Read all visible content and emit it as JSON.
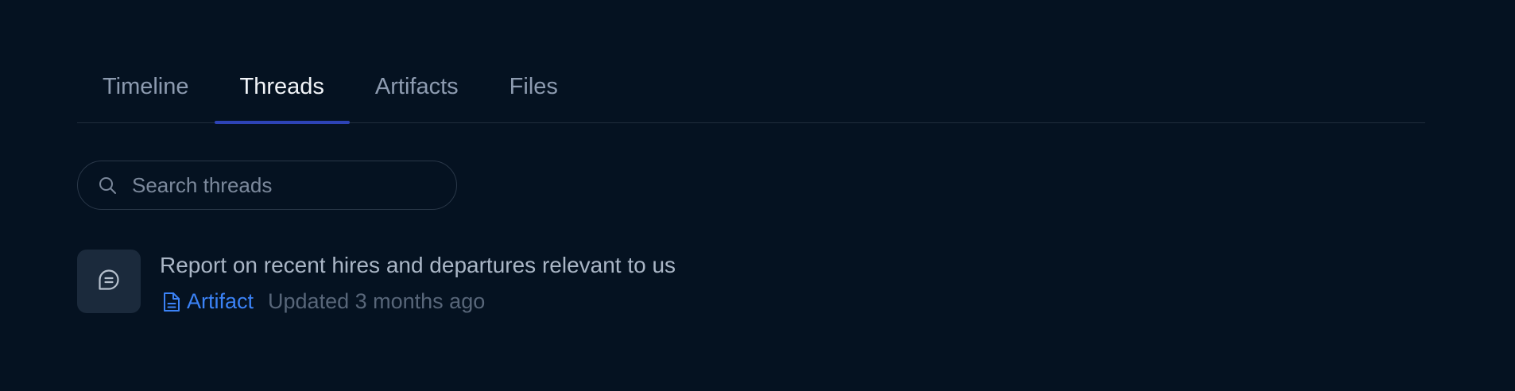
{
  "tabs": [
    {
      "label": "Timeline",
      "active": false
    },
    {
      "label": "Threads",
      "active": true
    },
    {
      "label": "Artifacts",
      "active": false
    },
    {
      "label": "Files",
      "active": false
    }
  ],
  "search": {
    "placeholder": "Search threads",
    "value": ""
  },
  "threads": [
    {
      "title": "Report on recent hires and departures relevant to us",
      "icon": "chat-bubble-icon",
      "badge": {
        "label": "Artifact",
        "icon": "document-icon"
      },
      "updated": "Updated 3 months ago"
    }
  ],
  "colors": {
    "background": "#051221",
    "accent": "#2d43b6",
    "link": "#3b82f6"
  }
}
